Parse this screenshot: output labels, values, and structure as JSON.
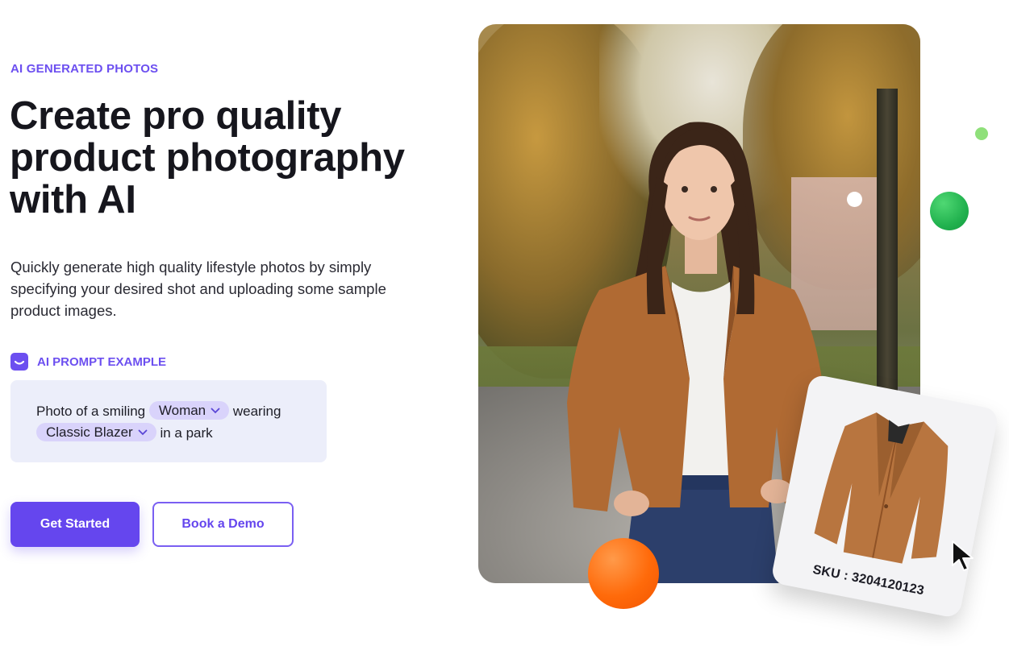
{
  "eyebrow": "AI GENERATED PHOTOS",
  "headline": {
    "line1": "Create pro quality",
    "line2": "product photography",
    "line3": "with AI"
  },
  "subtext": "Quickly generate high quality lifestyle photos by simply specifying your desired shot and uploading some sample product images.",
  "prompt": {
    "label": "AI PROMPT EXAMPLE",
    "icon": "smile-icon",
    "text_before": "Photo of a smiling",
    "subject_chip": "Woman",
    "text_middle": "wearing",
    "product_chip": "Classic Blazer",
    "text_after": "in a park"
  },
  "buttons": {
    "primary": "Get Started",
    "secondary": "Book a Demo"
  },
  "product_card": {
    "sku": "SKU : 3204120123"
  },
  "colors": {
    "accent": "#6546ee",
    "prompt_bg": "#eceefa",
    "chip_bg": "#d9d3fb",
    "orange": "#ff6a0a",
    "green": "#22b24f"
  }
}
